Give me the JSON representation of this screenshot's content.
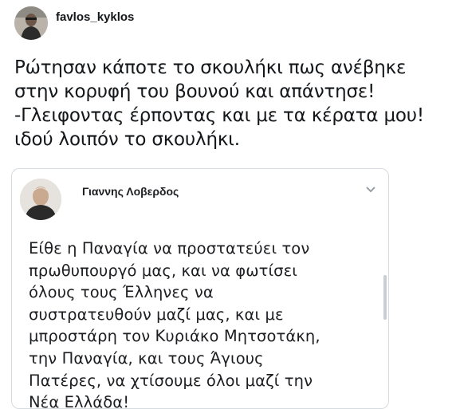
{
  "tweet": {
    "username": "favlos_kyklos",
    "lines": [
      "Ρώτησαν κάποτε το σκουλήκι πως ανέβηκε",
      "στην κορυφή του βουνού και απάντησε!",
      "-Γλειφοντας έρποντας και με τα κέρατα μου!",
      "ιδού λοιπόν το σκουλήκι."
    ]
  },
  "embedded_post": {
    "author": "Γιαννης Λοβερδος",
    "lines": [
      "Είθε η Παναγία να προστατεύει τον",
      "πρωθυπουργό μας, και να φωτίσει",
      "όλους τους Έλληνες να",
      "συστρατευθούν μαζί μας, και με",
      "μπροστάρη τον Κυριάκο Μητσοτάκη,",
      "την Παναγία, και τους Άγιους",
      "Πατέρες, να χτίσουμε όλοι μαζί την",
      "Νέα Ελλάδα!"
    ]
  }
}
